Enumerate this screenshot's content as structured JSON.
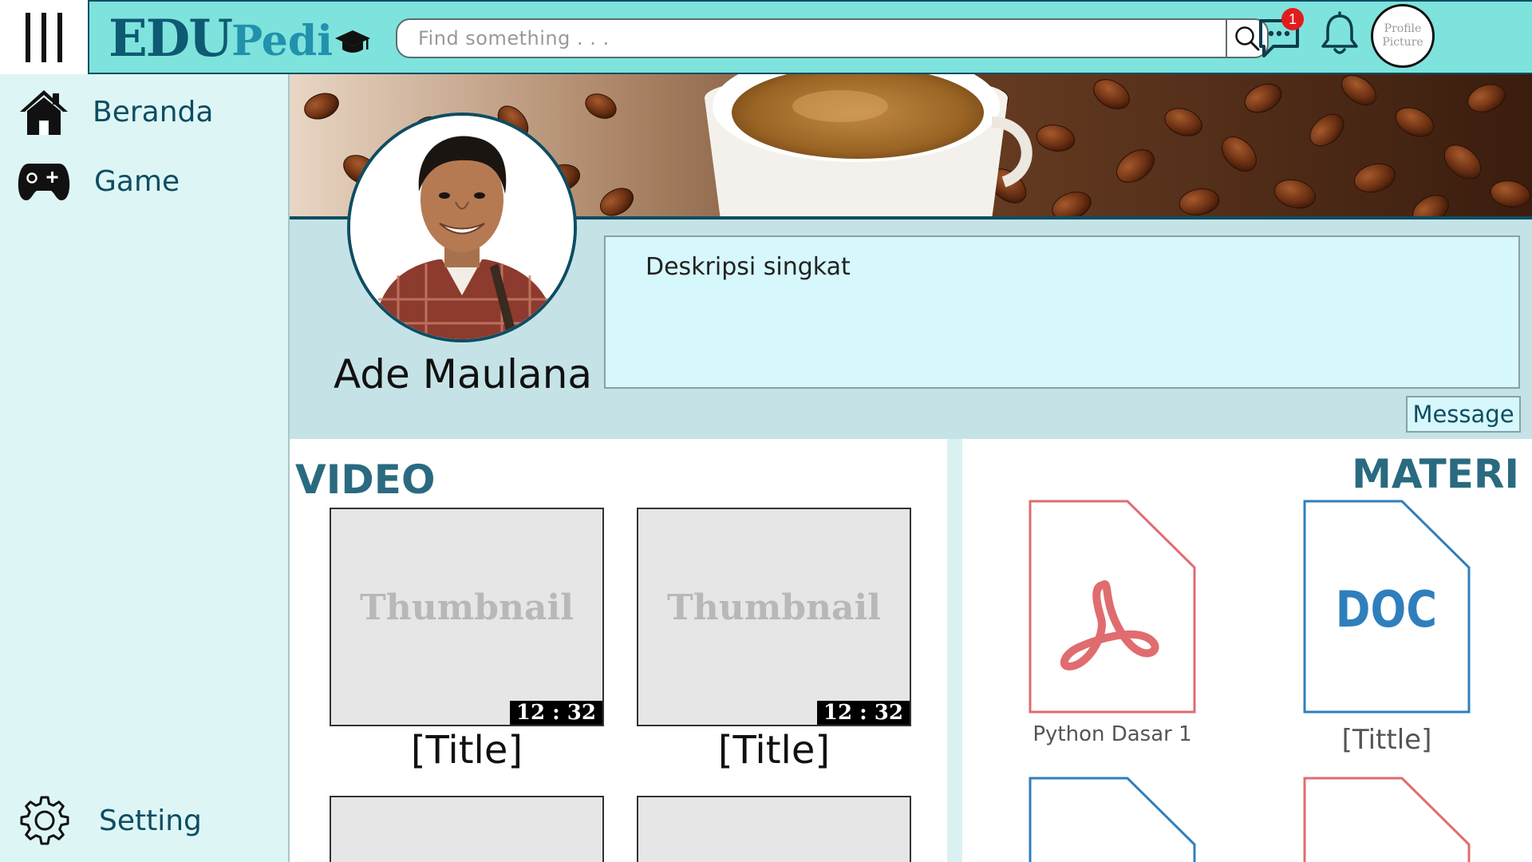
{
  "app": {
    "logo_main": "EDU",
    "logo_sub": "Pedi"
  },
  "search": {
    "placeholder": "Find something . . ."
  },
  "header": {
    "chat_badge": "1",
    "profile_label": "Profile Picture"
  },
  "sidebar": {
    "items": [
      {
        "label": "Beranda",
        "icon": "home-icon"
      },
      {
        "label": "Game",
        "icon": "gamepad-icon"
      },
      {
        "label": "Setting",
        "icon": "gear-icon"
      }
    ]
  },
  "profile": {
    "name": "Ade Maulana",
    "description": "Deskripsi singkat",
    "message_label": "Message"
  },
  "video": {
    "title": "VIDEO",
    "items": [
      {
        "thumbnail": "Thumbnail",
        "duration": "12 : 32",
        "title": "[Title]"
      },
      {
        "thumbnail": "Thumbnail",
        "duration": "12 : 32",
        "title": "[Title]"
      }
    ]
  },
  "materi": {
    "title": "MATERI",
    "items": [
      {
        "type": "pdf",
        "label": "Python Dasar 1",
        "color": "#e06c70"
      },
      {
        "type": "doc",
        "label": "[Tittle]",
        "color": "#2f7fbd",
        "badge": "DOC"
      }
    ]
  },
  "colors": {
    "topbar": "#7ee3dc",
    "sidebar": "#ddf6f5",
    "accent": "#0e4d63",
    "profile_band": "#c5e3e6"
  }
}
